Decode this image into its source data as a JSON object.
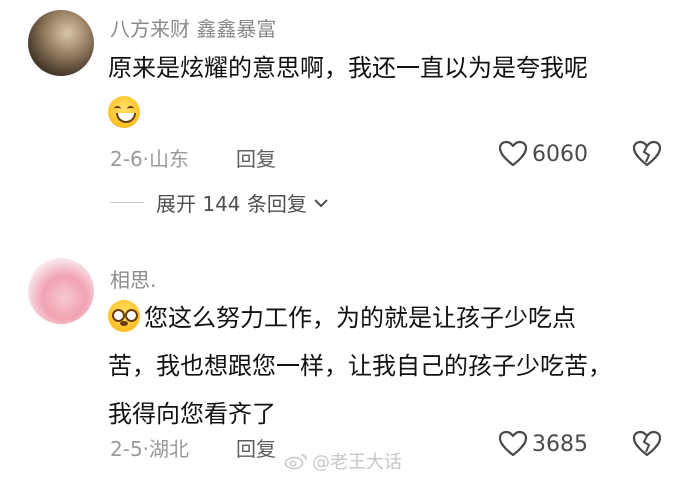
{
  "comments": [
    {
      "username": "八方来财 鑫鑫暴富",
      "text_lines": [
        "原来是炫耀的意思啊，我还一直以为是夸我呢"
      ],
      "date_location": "2-6·山东",
      "reply_label": "回复",
      "likes": "6060",
      "expand_label": "展开 144 条回复"
    },
    {
      "username": "相思.",
      "text_lines": [
        "您这么努力工作，为的就是让孩子少吃点",
        "苦，我也想跟您一样，让我自己的孩子少吃苦，",
        "我得向您看齐了"
      ],
      "date_location": "2-5·湖北",
      "reply_label": "回复",
      "likes": "3685"
    }
  ],
  "watermark": "@老王大话",
  "colors": {
    "text": "#111111",
    "meta": "#9a9a9a",
    "icon": "#4a4a4a"
  }
}
